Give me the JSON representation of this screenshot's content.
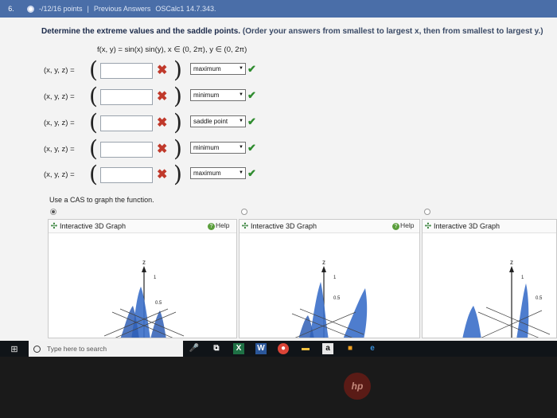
{
  "header": {
    "question_number": "6.",
    "points": "-/12/16 points",
    "previous_answers": "Previous Answers",
    "course_code": "OSCalc1 14.7.343."
  },
  "prompt": {
    "main": "Determine the extreme values and the saddle points.",
    "detail": "(Order your answers from smallest to largest x, then from smallest to largest y.)",
    "function": "f(x, y) = sin(x) sin(y),  x ∈ (0, 2π),  y ∈ (0, 2π)"
  },
  "rows": [
    {
      "label": "(x, y, z) =",
      "answer": "",
      "type": "maximum"
    },
    {
      "label": "(x, y, z) =",
      "answer": "",
      "type": "minimum"
    },
    {
      "label": "(x, y, z) =",
      "answer": "",
      "type": "saddle point"
    },
    {
      "label": "(x, y, z) =",
      "answer": "",
      "type": "minimum"
    },
    {
      "label": "(x, y, z) =",
      "answer": "",
      "type": "maximum"
    }
  ],
  "marks": {
    "incorrect": "✖",
    "correct": "✔",
    "dropdown_arrow": "▼"
  },
  "cas_instruction": "Use a CAS to graph the function.",
  "graphs": [
    {
      "title": "Interactive 3D Graph",
      "help": "Help",
      "z_axis": "z",
      "tick_top": "1",
      "tick_mid": "0.5",
      "selected": true
    },
    {
      "title": "Interactive 3D Graph",
      "help": "Help",
      "z_axis": "z",
      "tick_top": "1",
      "tick_mid": "0.5",
      "selected": false
    },
    {
      "title": "Interactive 3D Graph",
      "help": "",
      "z_axis": "z",
      "tick_top": "1",
      "tick_mid": "0.5",
      "selected": false
    }
  ],
  "taskbar": {
    "search_placeholder": "Type here to search",
    "word_icon": "W",
    "excel_icon": "X",
    "amazon_icon": "a",
    "ie_icon": "e"
  },
  "bezel": {
    "logo": "hp"
  },
  "colors": {
    "topbar": "#4a6ea8",
    "incorrect": "#c0392b",
    "correct": "#2e8b2e",
    "surface": "#3b6fc9"
  },
  "icons": [
    "windows-icon",
    "search-ring-icon",
    "microphone-icon",
    "task-view-icon",
    "excel-icon",
    "word-icon",
    "chrome-icon",
    "file-explorer-icon",
    "amazon-icon",
    "store-icon",
    "edge-icon"
  ]
}
